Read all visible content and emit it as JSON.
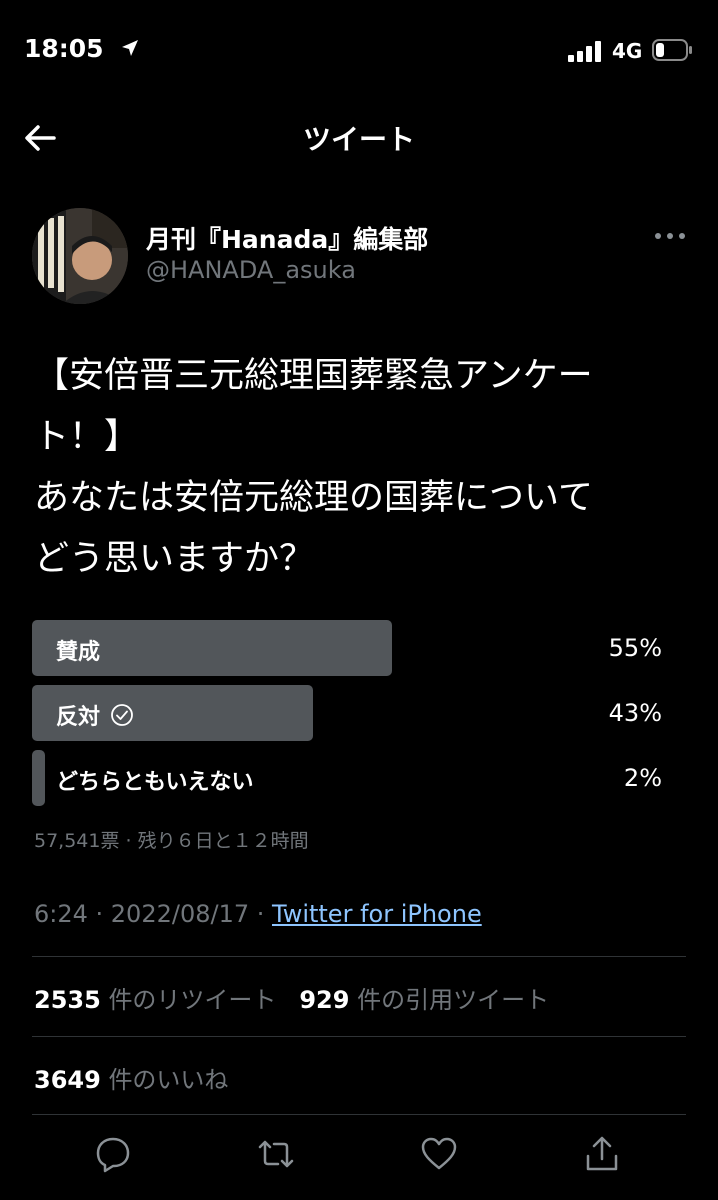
{
  "status_bar": {
    "time": "18:05",
    "network": "4G"
  },
  "header": {
    "title": "ツイート"
  },
  "author": {
    "name": "月刊『Hanada』編集部",
    "handle": "@HANADA_asuka"
  },
  "tweet": {
    "lines": [
      "【安倍晋三元総理国葬緊急アンケー",
      "ト！】",
      "あなたは安倍元総理の国葬について",
      "どう思いますか？"
    ]
  },
  "poll": {
    "options": [
      {
        "label": "賛成",
        "percent": "55%",
        "fraction": 0.55,
        "selected": false
      },
      {
        "label": "反対",
        "percent": "43%",
        "fraction": 0.43,
        "selected": true
      },
      {
        "label": "どちらともいえない",
        "percent": "2%",
        "fraction": 0.02,
        "selected": false
      }
    ],
    "meta": "57,541票 · 残り６日と１２時間"
  },
  "timestamp": {
    "time": "6:24 · 2022/08/17 · ",
    "source": "Twitter for iPhone"
  },
  "stats": {
    "retweets_count": "2535",
    "retweets_label": "件のリツイート",
    "quotes_count": "929",
    "quotes_label": "件の引用ツイート",
    "likes_count": "3649",
    "likes_label": "件のいいね"
  },
  "colors": {
    "background": "#000000",
    "link": "#8ec5ff",
    "muted": "#71767b",
    "poll_bar": "#52565a"
  }
}
